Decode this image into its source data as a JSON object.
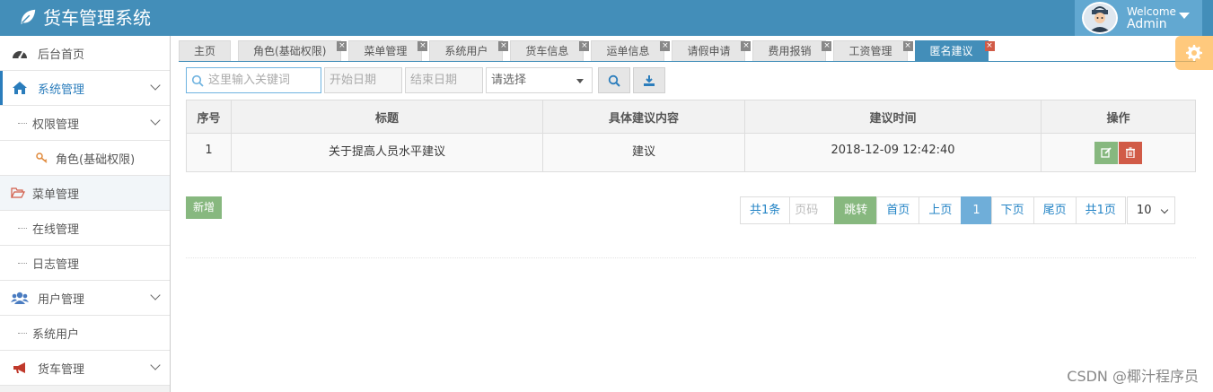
{
  "app": {
    "title": "货车管理系统"
  },
  "user": {
    "welcome": "Welcome",
    "name": "Admin"
  },
  "sidebar": {
    "items": [
      {
        "label": "后台首页"
      },
      {
        "label": "系统管理"
      },
      {
        "label": "权限管理"
      },
      {
        "label": "角色(基础权限)"
      },
      {
        "label": "菜单管理"
      },
      {
        "label": "在线管理"
      },
      {
        "label": "日志管理"
      },
      {
        "label": "用户管理"
      },
      {
        "label": "系统用户"
      },
      {
        "label": "货车管理"
      }
    ]
  },
  "tabs": [
    {
      "label": "主页"
    },
    {
      "label": "角色(基础权限)"
    },
    {
      "label": "菜单管理"
    },
    {
      "label": "系统用户"
    },
    {
      "label": "货车信息"
    },
    {
      "label": "运单信息"
    },
    {
      "label": "请假申请"
    },
    {
      "label": "费用报销"
    },
    {
      "label": "工资管理"
    },
    {
      "label": "匿名建议"
    }
  ],
  "tab_close": "×",
  "search": {
    "keyword_placeholder": "这里输入关键词",
    "start_placeholder": "开始日期",
    "end_placeholder": "结束日期",
    "select_value": "请选择"
  },
  "table": {
    "headers": [
      "序号",
      "标题",
      "具体建议内容",
      "建议时间",
      "操作"
    ],
    "rows": [
      {
        "no": "1",
        "title": "关于提高人员水平建议",
        "content": "建议",
        "time": "2018-12-09 12:42:40"
      }
    ]
  },
  "add_button": "新增",
  "pager": {
    "total": "共1条",
    "page_input_placeholder": "页码",
    "go": "跳转",
    "first": "首页",
    "prev": "上页",
    "current": "1",
    "next": "下页",
    "last": "尾页",
    "pages": "共1页",
    "page_size": "10"
  },
  "watermark": "CSDN @椰汁程序员",
  "colors": {
    "header": "#438eb9",
    "accent": "#2b7dbc",
    "success": "#87b87f",
    "danger": "#d15b47",
    "warning": "#ffb752"
  }
}
